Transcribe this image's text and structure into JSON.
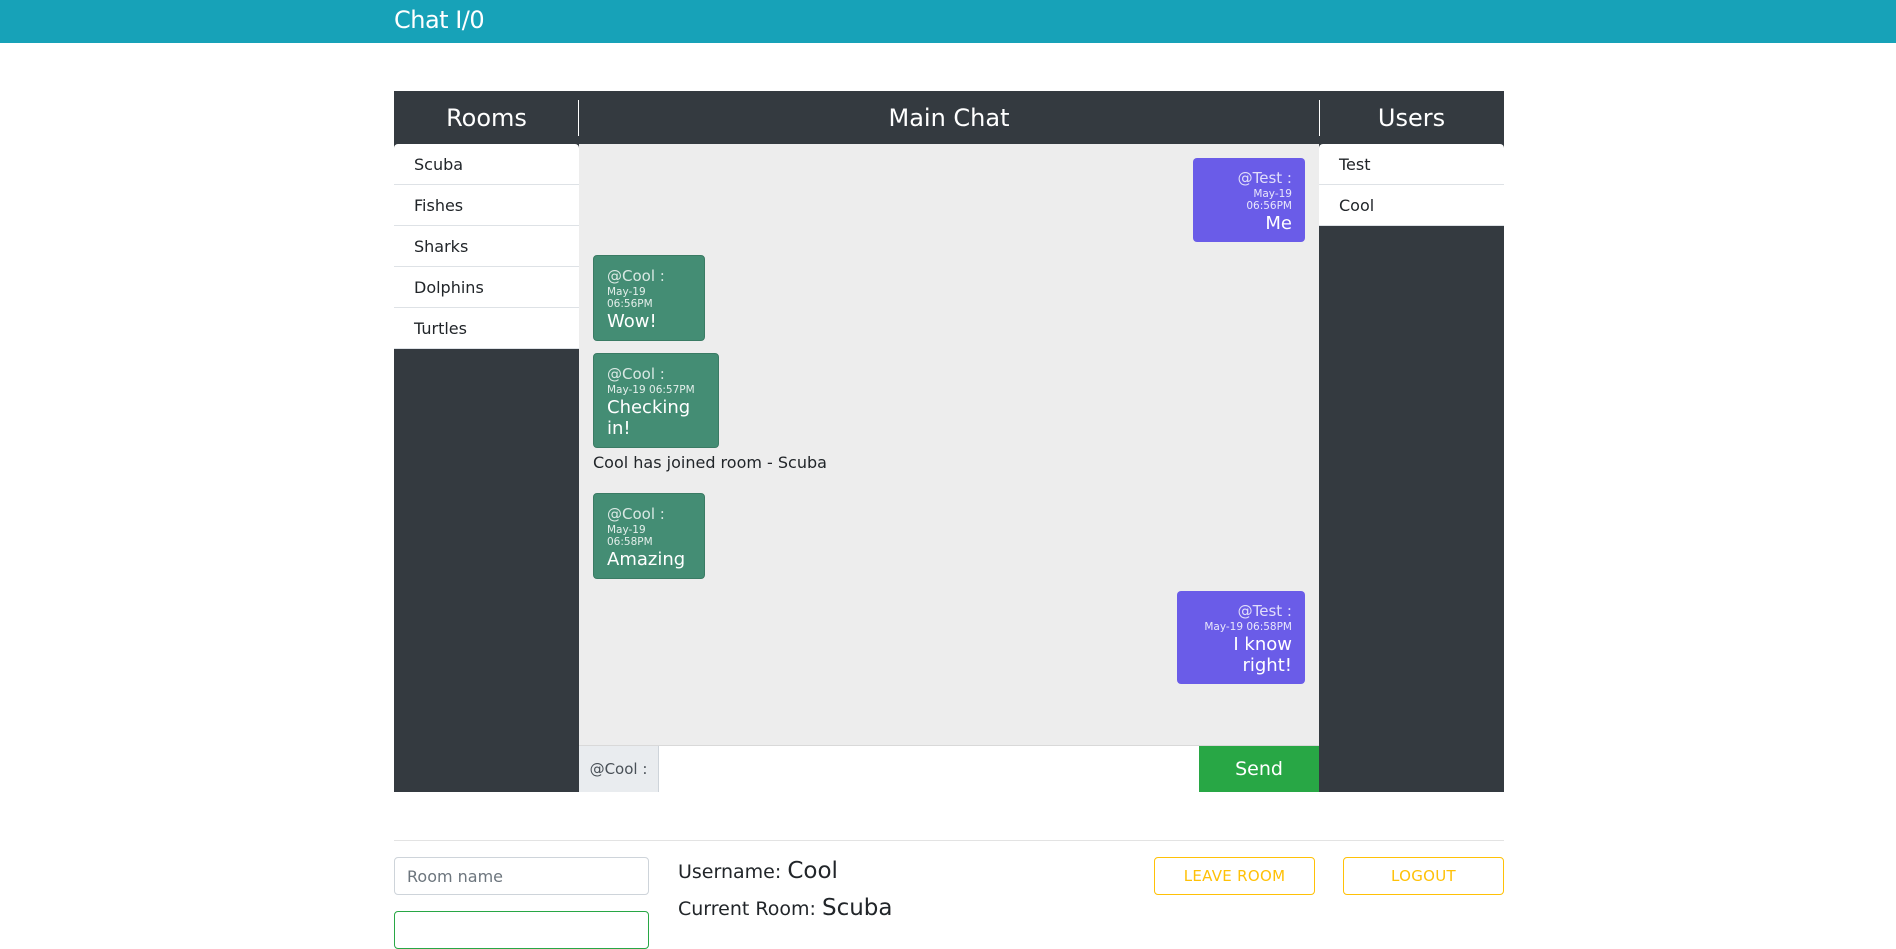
{
  "app": {
    "brand": "Chat I/0"
  },
  "rooms": {
    "title": "Rooms",
    "items": [
      "Scuba",
      "Fishes",
      "Sharks",
      "Dolphins",
      "Turtles"
    ]
  },
  "main": {
    "title": "Main Chat",
    "messages": [
      {
        "who": "@Test :",
        "time": "May-19 06:56PM",
        "text": "Me"
      },
      {
        "who": "@Cool :",
        "time": "May-19 06:56PM",
        "text": "Wow!"
      },
      {
        "who": "@Cool :",
        "time": "May-19 06:57PM",
        "text": "Checking in!"
      },
      {
        "notice": "Cool has joined room - Scuba"
      },
      {
        "who": "@Cool :",
        "time": "May-19 06:58PM",
        "text": "Amazing"
      },
      {
        "who": "@Test :",
        "time": "May-19 06:58PM",
        "text": "I know right!"
      }
    ],
    "compose": {
      "prefix": "@Cool :",
      "value": "",
      "send_label": "Send"
    }
  },
  "users": {
    "title": "Users",
    "items": [
      "Test",
      "Cool"
    ]
  },
  "footer": {
    "room_name_placeholder": "Room name",
    "username_label": "Username:",
    "username_value": "Cool",
    "room_label": "Current Room:",
    "room_value": "Scuba",
    "leave_label": "LEAVE ROOM",
    "logout_label": "LOGOUT"
  },
  "colors": {
    "topbar": "#17a2b8",
    "panel": "#343a40",
    "mine_bubble": "#6a5ce8",
    "their_bubble": "#448d74",
    "send": "#28a745",
    "warning": "#ffc107"
  }
}
